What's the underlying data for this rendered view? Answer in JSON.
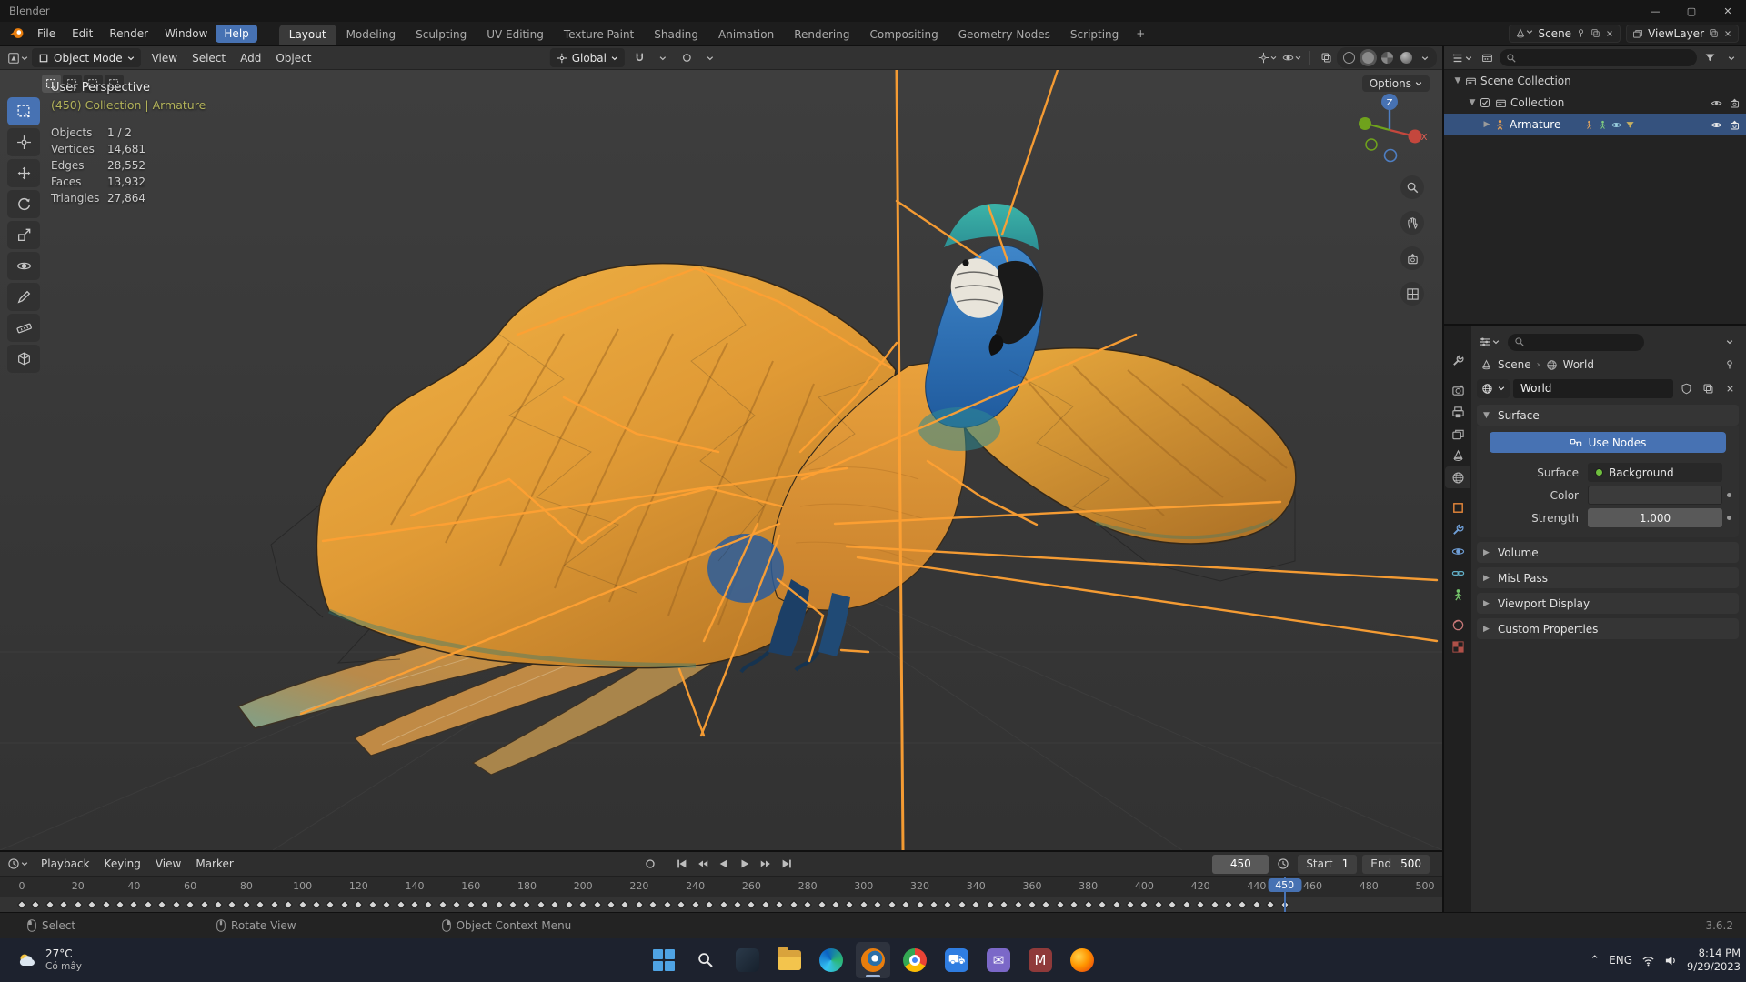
{
  "colors": {
    "accent": "#4772b3",
    "blender_orange": "#e87d0d",
    "armature_orange": "#ffa133"
  },
  "titlebar": {
    "title": "Blender"
  },
  "menubar": {
    "menus": [
      "File",
      "Edit",
      "Render",
      "Window",
      "Help"
    ],
    "highlighted_menu": "Help",
    "workspaces": [
      "Layout",
      "Modeling",
      "Sculpting",
      "UV Editing",
      "Texture Paint",
      "Shading",
      "Animation",
      "Rendering",
      "Compositing",
      "Geometry Nodes",
      "Scripting"
    ],
    "active_workspace": "Layout",
    "add_workspace": "+",
    "scene": "Scene",
    "viewlayer": "ViewLayer"
  },
  "viewport_header": {
    "mode": "Object Mode",
    "menus": [
      "View",
      "Select",
      "Add",
      "Object"
    ],
    "orientation": "Global"
  },
  "viewport": {
    "options": "Options",
    "view_label": "User Perspective",
    "context_label": "(450) Collection | Armature",
    "stats": [
      {
        "label": "Objects",
        "value": "1 / 2"
      },
      {
        "label": "Vertices",
        "value": "14,681"
      },
      {
        "label": "Edges",
        "value": "28,552"
      },
      {
        "label": "Faces",
        "value": "13,932"
      },
      {
        "label": "Triangles",
        "value": "27,864"
      }
    ],
    "gizmo_z": "Z",
    "gizmo_x": "X"
  },
  "outliner": {
    "rows": [
      {
        "label": "Scene Collection"
      },
      {
        "label": "Collection"
      },
      {
        "label": "Armature"
      }
    ]
  },
  "properties": {
    "breadcrumb_scene": "Scene",
    "breadcrumb_world": "World",
    "datablock_name": "World",
    "surface_title": "Surface",
    "use_nodes": "Use Nodes",
    "surface_label": "Surface",
    "surface_value": "Background",
    "color_label": "Color",
    "strength_label": "Strength",
    "strength_value": "1.000",
    "collapsed_panels": [
      "Volume",
      "Mist Pass",
      "Viewport Display",
      "Custom Properties"
    ]
  },
  "timeline": {
    "menus": [
      "Playback",
      "Keying",
      "View",
      "Marker"
    ],
    "current_frame": "450",
    "start_label": "Start",
    "start_value": "1",
    "end_label": "End",
    "end_value": "500",
    "frame_min": 0,
    "frame_max": 500,
    "ticks": [
      "0",
      "20",
      "40",
      "60",
      "80",
      "100",
      "120",
      "140",
      "160",
      "180",
      "200",
      "220",
      "240",
      "260",
      "280",
      "300",
      "320",
      "340",
      "360",
      "380",
      "400",
      "420",
      "440",
      "460",
      "480",
      "500"
    ],
    "keyframe_last": 450,
    "keyframe_step": 5
  },
  "statusbar": {
    "hints": [
      {
        "label": "Select"
      },
      {
        "label": "Rotate View"
      },
      {
        "label": "Object Context Menu"
      }
    ],
    "version": "3.6.2"
  },
  "taskbar": {
    "weather_temp": "27°C",
    "weather_desc": "Có mây",
    "apps": [
      "start",
      "search",
      "widgets",
      "file-explorer",
      "edge",
      "blender",
      "chrome",
      "store",
      "mail",
      "word",
      "firefox"
    ],
    "active_app": "blender",
    "tray_lang": "ENG",
    "time": "8:14 PM",
    "date": "9/29/2023"
  }
}
